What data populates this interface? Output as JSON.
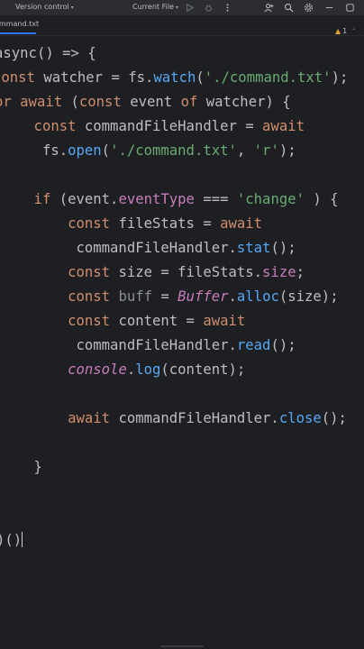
{
  "toolbar": {
    "vcs_label": "Version control",
    "run_config_label": "Current File"
  },
  "tabs": [
    {
      "label": "ommand.txt"
    }
  ],
  "inspection": {
    "warning_count": "1"
  },
  "code": {
    "lines": [
      [
        {
          "t": "async() => {",
          "c": "plain"
        }
      ],
      [
        {
          "t": "const ",
          "c": "kw"
        },
        {
          "t": "watcher = fs.",
          "c": "plain"
        },
        {
          "t": "watch",
          "c": "fn"
        },
        {
          "t": "(",
          "c": "plain"
        },
        {
          "t": "'./command.txt'",
          "c": "str"
        },
        {
          "t": ");",
          "c": "plain"
        }
      ],
      [
        {
          "t": "or await ",
          "c": "kw"
        },
        {
          "t": "(",
          "c": "plain"
        },
        {
          "t": "const ",
          "c": "kw"
        },
        {
          "t": "event ",
          "c": "plain"
        },
        {
          "t": "of ",
          "c": "kw"
        },
        {
          "t": "watcher) {",
          "c": "plain"
        }
      ],
      [
        {
          "t": "    const ",
          "c": "kw"
        },
        {
          "t": "commandFileHandler = ",
          "c": "plain"
        },
        {
          "t": "await",
          "c": "kw"
        }
      ],
      [
        {
          "t": "     fs.",
          "c": "plain"
        },
        {
          "t": "open",
          "c": "fn"
        },
        {
          "t": "(",
          "c": "plain"
        },
        {
          "t": "'./command.txt'",
          "c": "str"
        },
        {
          "t": ", ",
          "c": "plain"
        },
        {
          "t": "'r'",
          "c": "str"
        },
        {
          "t": ");",
          "c": "plain"
        }
      ],
      [
        {
          "t": "",
          "c": "plain"
        }
      ],
      [
        {
          "t": "    if ",
          "c": "kw"
        },
        {
          "t": "(event.",
          "c": "plain"
        },
        {
          "t": "eventType",
          "c": "prop"
        },
        {
          "t": " === ",
          "c": "plain"
        },
        {
          "t": "'change'",
          "c": "str"
        },
        {
          "t": " ) {",
          "c": "plain"
        }
      ],
      [
        {
          "t": "        const ",
          "c": "kw"
        },
        {
          "t": "fileStats = ",
          "c": "plain"
        },
        {
          "t": "await",
          "c": "kw"
        }
      ],
      [
        {
          "t": "         commandFileHandler.",
          "c": "plain"
        },
        {
          "t": "stat",
          "c": "fn"
        },
        {
          "t": "();",
          "c": "plain"
        }
      ],
      [
        {
          "t": "        const ",
          "c": "kw"
        },
        {
          "t": "size = fileStats.",
          "c": "plain"
        },
        {
          "t": "size",
          "c": "prop"
        },
        {
          "t": ";",
          "c": "plain"
        }
      ],
      [
        {
          "t": "        const ",
          "c": "kw"
        },
        {
          "t": "buff",
          "c": "dim"
        },
        {
          "t": " = ",
          "c": "plain"
        },
        {
          "t": "Buffer",
          "c": "cls"
        },
        {
          "t": ".",
          "c": "plain"
        },
        {
          "t": "alloc",
          "c": "fn"
        },
        {
          "t": "(size);",
          "c": "plain"
        }
      ],
      [
        {
          "t": "        const ",
          "c": "kw"
        },
        {
          "t": "content = ",
          "c": "plain"
        },
        {
          "t": "await",
          "c": "kw"
        }
      ],
      [
        {
          "t": "         commandFileHandler.",
          "c": "plain"
        },
        {
          "t": "read",
          "c": "fn"
        },
        {
          "t": "();",
          "c": "plain"
        }
      ],
      [
        {
          "t": "        ",
          "c": "plain"
        },
        {
          "t": "console",
          "c": "cls"
        },
        {
          "t": ".",
          "c": "plain"
        },
        {
          "t": "log",
          "c": "fn"
        },
        {
          "t": "(content);",
          "c": "plain"
        }
      ],
      [
        {
          "t": "",
          "c": "plain"
        }
      ],
      [
        {
          "t": "        await ",
          "c": "kw"
        },
        {
          "t": "commandFileHandler.",
          "c": "plain"
        },
        {
          "t": "close",
          "c": "fn"
        },
        {
          "t": "();",
          "c": "plain"
        }
      ],
      [
        {
          "t": "",
          "c": "plain"
        }
      ],
      [
        {
          "t": "    }",
          "c": "plain"
        }
      ],
      [
        {
          "t": "",
          "c": "plain"
        }
      ],
      [
        {
          "t": "",
          "c": "plain"
        }
      ],
      [
        {
          "t": ")()",
          "c": "plain"
        }
      ]
    ]
  }
}
